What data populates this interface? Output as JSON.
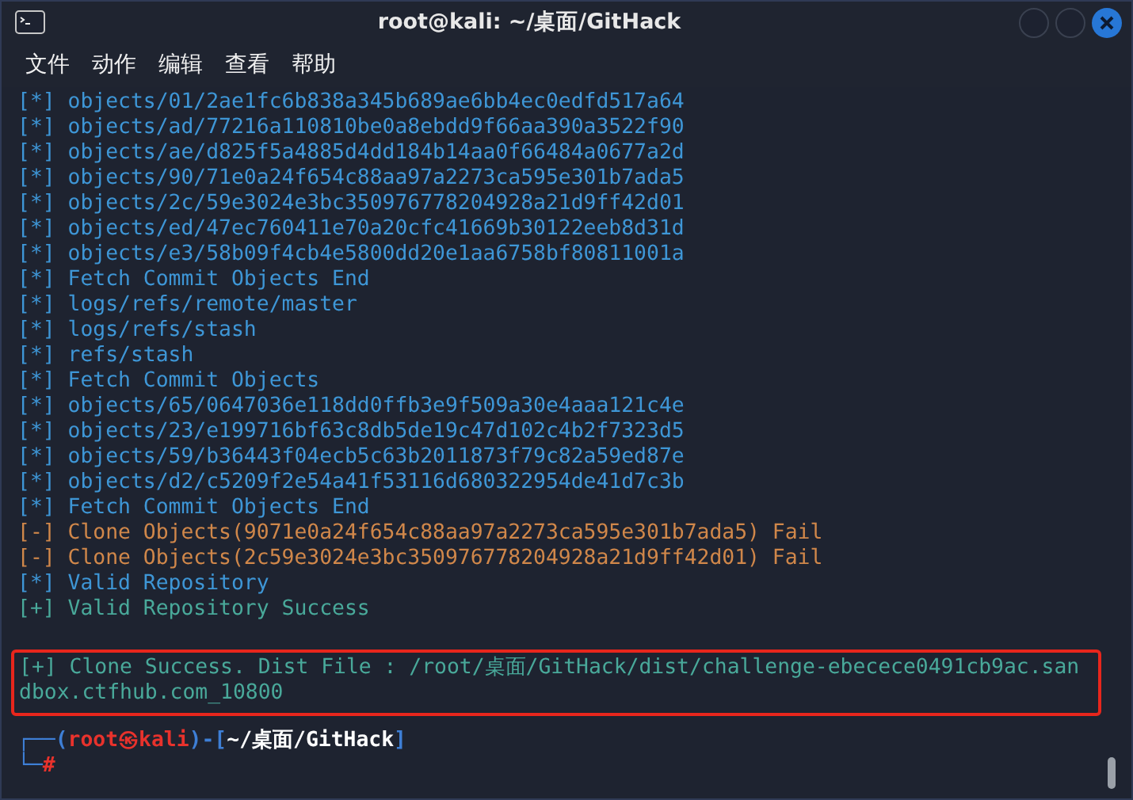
{
  "window": {
    "title": "root@kali: ~/桌面/GitHack"
  },
  "menu": [
    "文件",
    "动作",
    "编辑",
    "查看",
    "帮助"
  ],
  "lines": [
    {
      "kind": "info",
      "tag": "[*]",
      "text": "objects/01/2ae1fc6b838a345b689ae6bb4ec0edfd517a64"
    },
    {
      "kind": "info",
      "tag": "[*]",
      "text": "objects/ad/77216a110810be0a8ebdd9f66aa390a3522f90"
    },
    {
      "kind": "info",
      "tag": "[*]",
      "text": "objects/ae/d825f5a4885d4dd184b14aa0f66484a0677a2d"
    },
    {
      "kind": "info",
      "tag": "[*]",
      "text": "objects/90/71e0a24f654c88aa97a2273ca595e301b7ada5"
    },
    {
      "kind": "info",
      "tag": "[*]",
      "text": "objects/2c/59e3024e3bc350976778204928a21d9ff42d01"
    },
    {
      "kind": "info",
      "tag": "[*]",
      "text": "objects/ed/47ec760411e70a20cfc41669b30122eeb8d31d"
    },
    {
      "kind": "info",
      "tag": "[*]",
      "text": "objects/e3/58b09f4cb4e5800dd20e1aa6758bf80811001a"
    },
    {
      "kind": "info",
      "tag": "[*]",
      "text": "Fetch Commit Objects End"
    },
    {
      "kind": "info",
      "tag": "[*]",
      "text": "logs/refs/remote/master"
    },
    {
      "kind": "info",
      "tag": "[*]",
      "text": "logs/refs/stash"
    },
    {
      "kind": "info",
      "tag": "[*]",
      "text": "refs/stash"
    },
    {
      "kind": "info",
      "tag": "[*]",
      "text": "Fetch Commit Objects"
    },
    {
      "kind": "info",
      "tag": "[*]",
      "text": "objects/65/0647036e118dd0ffb3e9f509a30e4aaa121c4e"
    },
    {
      "kind": "info",
      "tag": "[*]",
      "text": "objects/23/e199716bf63c8db5de19c47d102c4b2f7323d5"
    },
    {
      "kind": "info",
      "tag": "[*]",
      "text": "objects/59/b36443f04ecb5c63b2011873f79c82a59ed87e"
    },
    {
      "kind": "info",
      "tag": "[*]",
      "text": "objects/d2/c5209f2e54a41f53116d680322954de41d7c3b"
    },
    {
      "kind": "info",
      "tag": "[*]",
      "text": "Fetch Commit Objects End"
    },
    {
      "kind": "fail",
      "tag": "[-]",
      "text": "Clone Objects(9071e0a24f654c88aa97a2273ca595e301b7ada5) Fail"
    },
    {
      "kind": "fail",
      "tag": "[-]",
      "text": "Clone Objects(2c59e3024e3bc350976778204928a21d9ff42d01) Fail"
    },
    {
      "kind": "info",
      "tag": "[*]",
      "text": "Valid Repository"
    },
    {
      "kind": "success",
      "tag": "[+]",
      "text": "Valid Repository Success"
    }
  ],
  "boxed_line": {
    "kind": "success",
    "tag": "[+]",
    "text": "Clone Success. Dist File : /root/桌面/GitHack/dist/challenge-ebecece0491cb9ac.sandbox.ctfhub.com_10800"
  },
  "prompt": {
    "corner_top": "┌──(",
    "user_host": "root㉿kali",
    "mid": ")-[",
    "cwd": "~/桌面/GitHack",
    "close": "]",
    "corner_bottom": "└─",
    "symbol": "#"
  }
}
